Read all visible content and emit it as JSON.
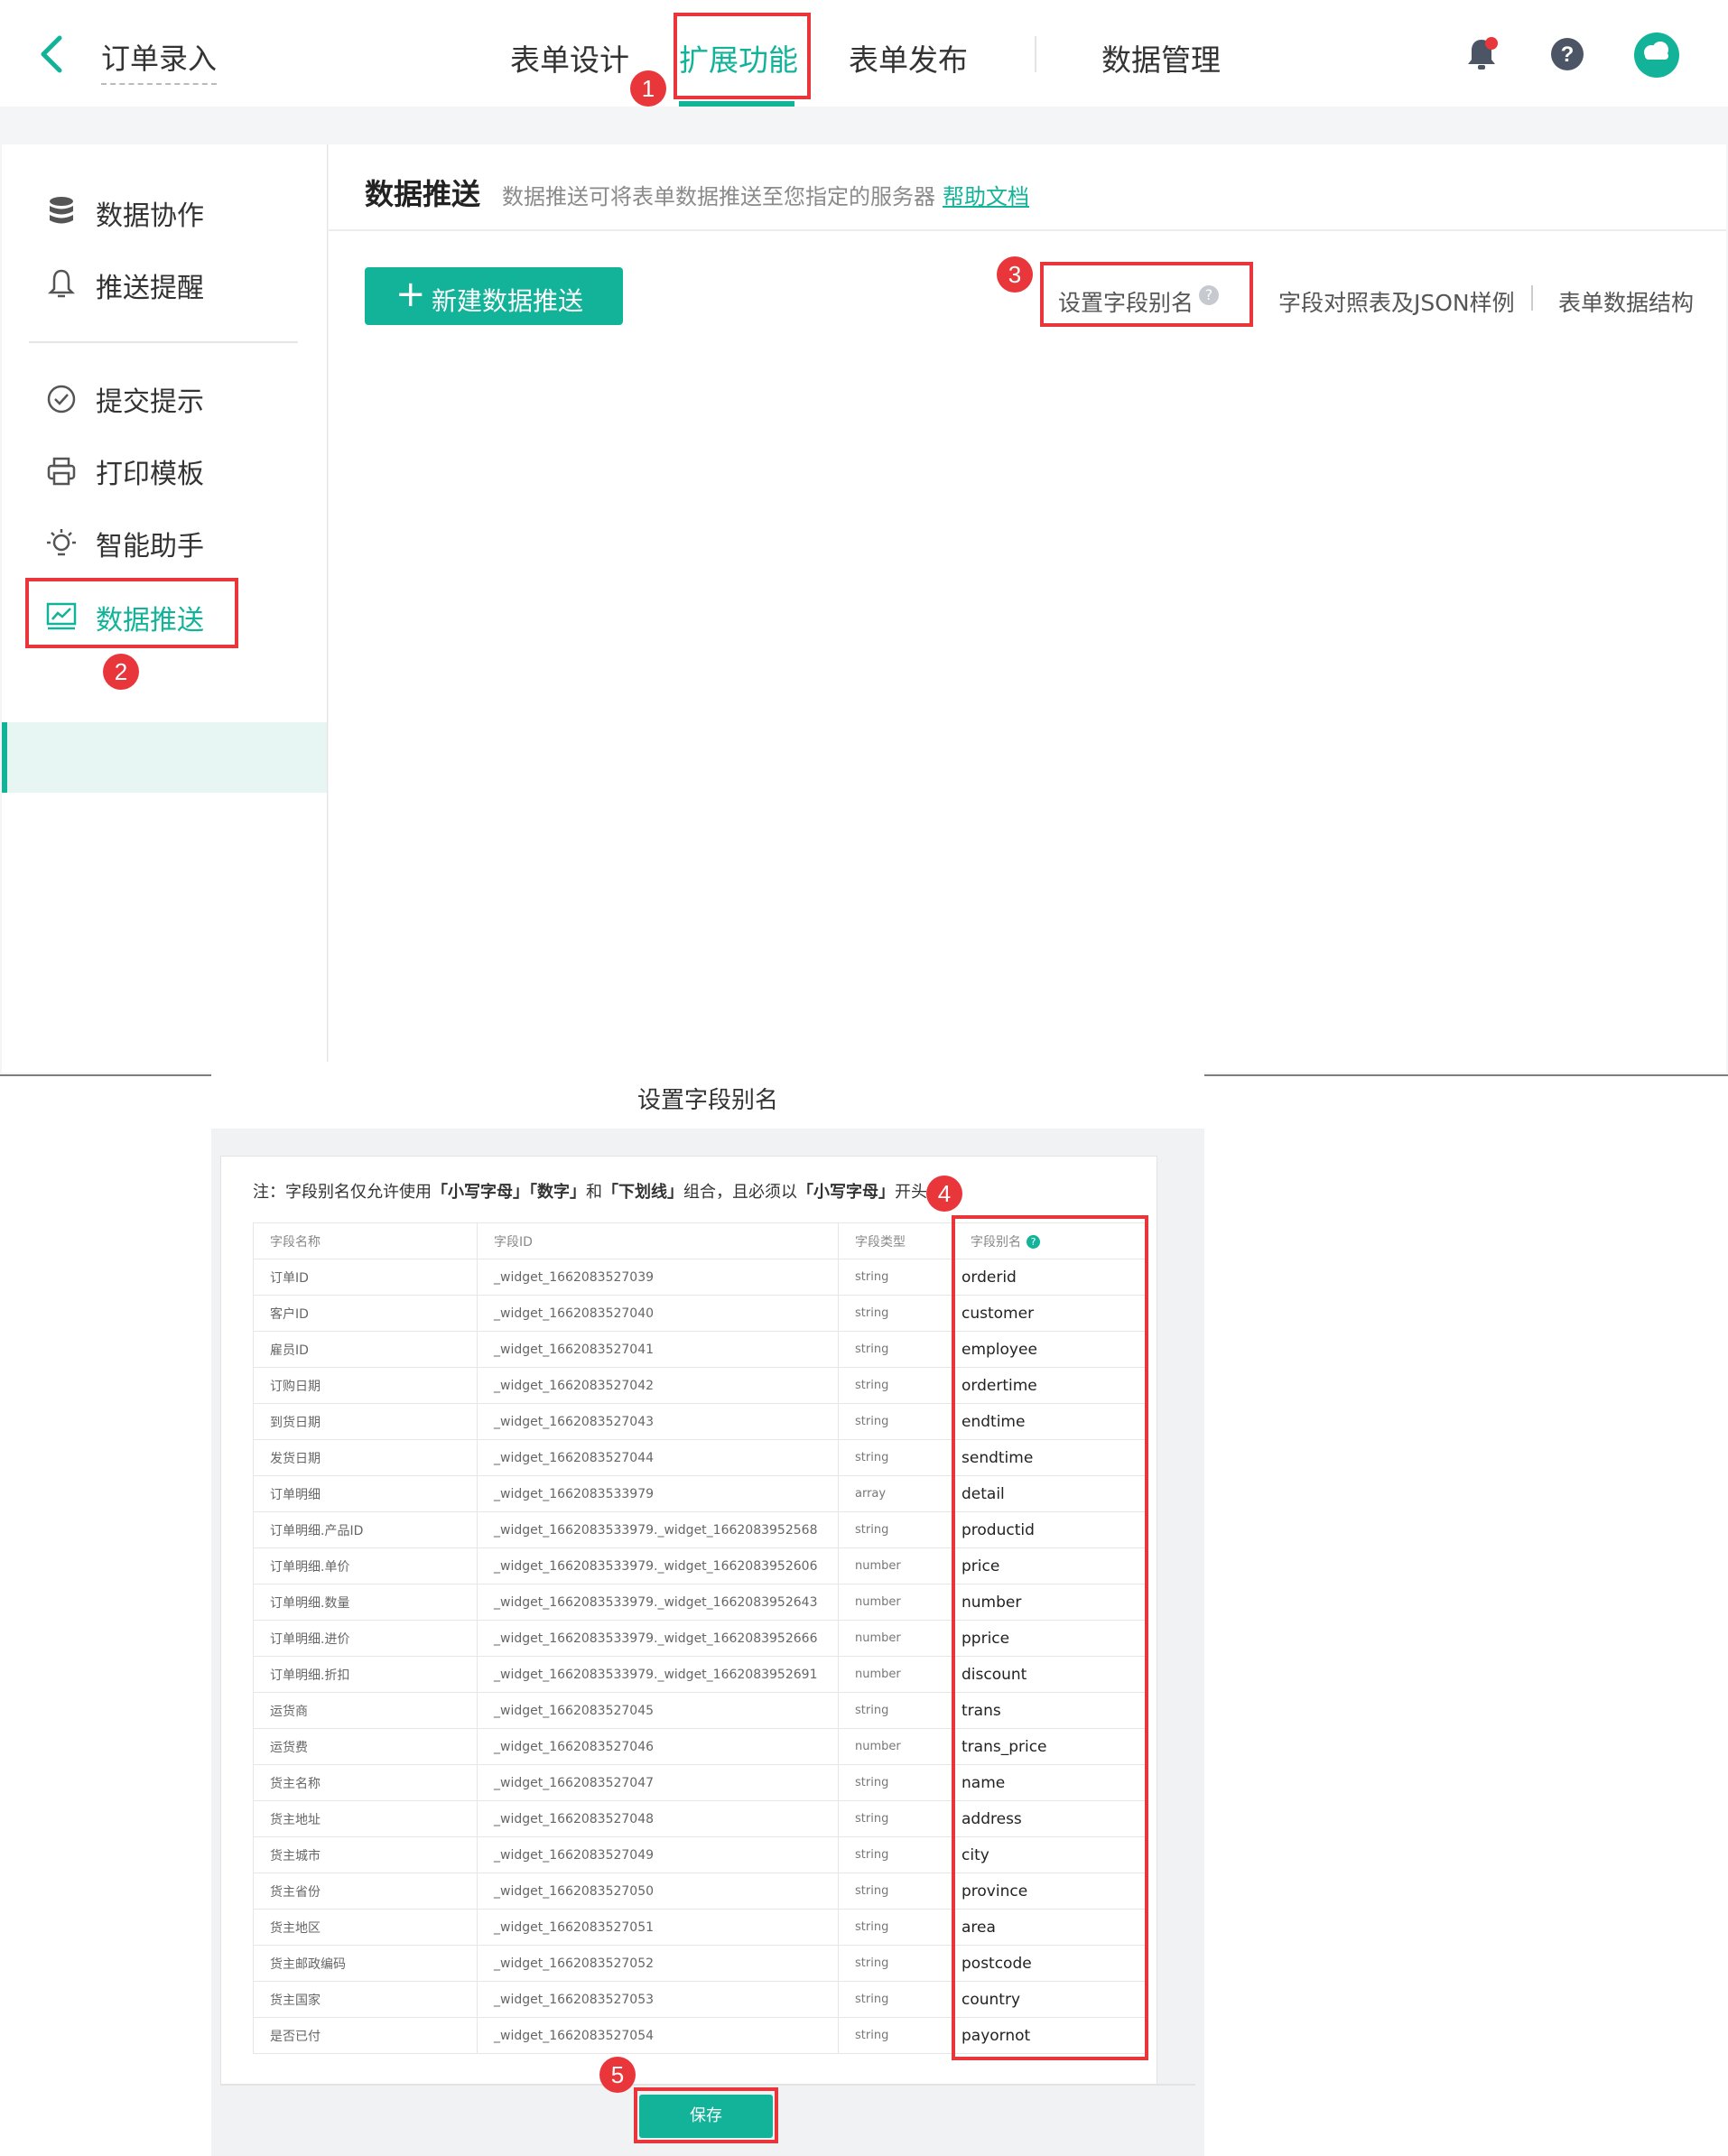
{
  "header": {
    "title": "订单录入",
    "tabs": [
      {
        "label": "表单设计"
      },
      {
        "label": "扩展功能",
        "active": true
      },
      {
        "label": "表单发布"
      },
      {
        "label": "数据管理"
      }
    ],
    "icons": [
      "bell-icon",
      "help-icon",
      "avatar"
    ]
  },
  "sidebar": {
    "items": [
      {
        "label": "数据协作",
        "icon": "database-icon"
      },
      {
        "label": "推送提醒",
        "icon": "bell-icon"
      },
      {
        "label": "提交提示",
        "icon": "check-circle-icon"
      },
      {
        "label": "打印模板",
        "icon": "printer-icon"
      },
      {
        "label": "智能助手",
        "icon": "lightbulb-icon"
      },
      {
        "label": "数据推送",
        "icon": "chart-icon",
        "active": true
      }
    ]
  },
  "main": {
    "title": "数据推送",
    "description": "数据推送可将表单数据推送至您指定的服务器",
    "help_link": "帮助文档",
    "new_button": "新建数据推送",
    "links": [
      "设置字段别名",
      "字段对照表及JSON样例",
      "表单数据结构"
    ]
  },
  "modal": {
    "title": "设置字段别名",
    "note_parts": [
      "注：字段别名仅允许使用",
      "「小写字母」",
      "「数字」",
      "和",
      "「下划线」",
      "组合，且必须以",
      "「小写字母」",
      "开头"
    ],
    "columns": [
      "字段名称",
      "字段ID",
      "字段类型",
      "字段别名"
    ],
    "rows": [
      [
        "订单ID",
        "_widget_1662083527039",
        "string",
        "orderid"
      ],
      [
        "客户ID",
        "_widget_1662083527040",
        "string",
        "customer"
      ],
      [
        "雇员ID",
        "_widget_1662083527041",
        "string",
        "employee"
      ],
      [
        "订购日期",
        "_widget_1662083527042",
        "string",
        "ordertime"
      ],
      [
        "到货日期",
        "_widget_1662083527043",
        "string",
        "endtime"
      ],
      [
        "发货日期",
        "_widget_1662083527044",
        "string",
        "sendtime"
      ],
      [
        "订单明细",
        "_widget_1662083533979",
        "array",
        "detail"
      ],
      [
        "订单明细.产品ID",
        "_widget_1662083533979._widget_1662083952568",
        "string",
        "productid"
      ],
      [
        "订单明细.单价",
        "_widget_1662083533979._widget_1662083952606",
        "number",
        "price"
      ],
      [
        "订单明细.数量",
        "_widget_1662083533979._widget_1662083952643",
        "number",
        "number"
      ],
      [
        "订单明细.进价",
        "_widget_1662083533979._widget_1662083952666",
        "number",
        "pprice"
      ],
      [
        "订单明细.折扣",
        "_widget_1662083533979._widget_1662083952691",
        "number",
        "discount"
      ],
      [
        "运货商",
        "_widget_1662083527045",
        "string",
        "trans"
      ],
      [
        "运货费",
        "_widget_1662083527046",
        "number",
        "trans_price"
      ],
      [
        "货主名称",
        "_widget_1662083527047",
        "string",
        "name"
      ],
      [
        "货主地址",
        "_widget_1662083527048",
        "string",
        "address"
      ],
      [
        "货主城市",
        "_widget_1662083527049",
        "string",
        "city"
      ],
      [
        "货主省份",
        "_widget_1662083527050",
        "string",
        "province"
      ],
      [
        "货主地区",
        "_widget_1662083527051",
        "string",
        "area"
      ],
      [
        "货主邮政编码",
        "_widget_1662083527052",
        "string",
        "postcode"
      ],
      [
        "货主国家",
        "_widget_1662083527053",
        "string",
        "country"
      ],
      [
        "是否已付",
        "_widget_1662083527054",
        "string",
        "payornot"
      ]
    ],
    "save_button": "保存"
  },
  "annotations": [
    "1",
    "2",
    "3",
    "4",
    "5"
  ],
  "colors": {
    "accent": "#13b39a",
    "highlight": "#e8363b"
  }
}
